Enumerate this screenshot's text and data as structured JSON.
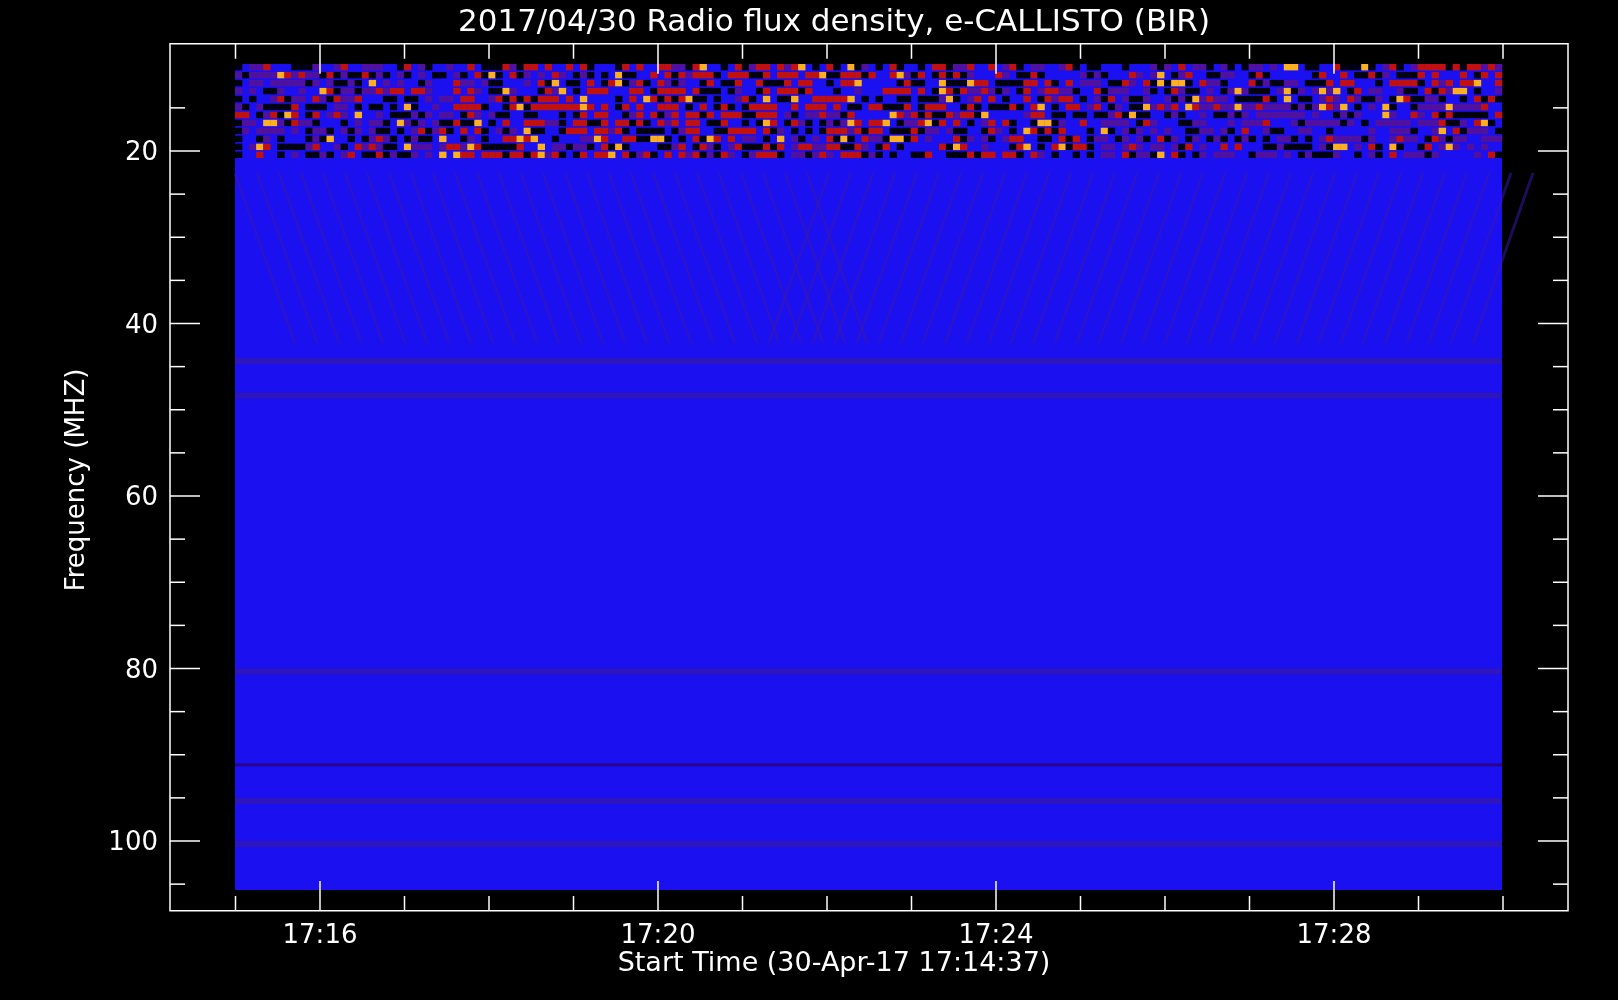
{
  "title": "2017/04/30  Radio flux density, e-CALLISTO (BIR)",
  "y_axis": {
    "label": "Frequency (MHZ)",
    "ticks": [
      "20",
      "40",
      "60",
      "80",
      "100"
    ]
  },
  "x_axis": {
    "label": "Start Time (30-Apr-17 17:14:37)",
    "ticks": [
      "17:16",
      "17:20",
      "17:24",
      "17:28"
    ]
  }
}
